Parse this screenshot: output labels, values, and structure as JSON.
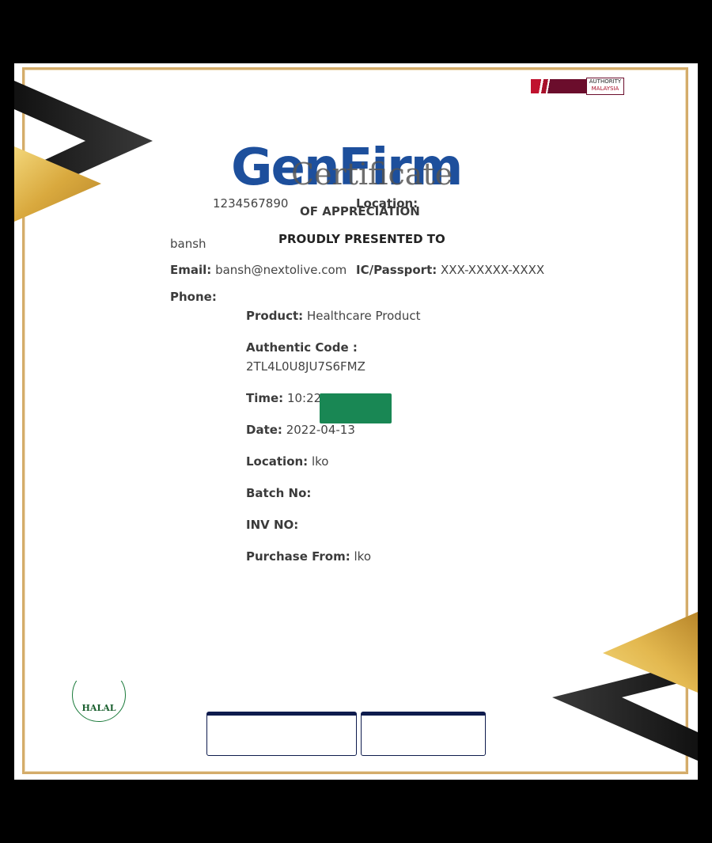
{
  "header": {
    "logo_text": "GenFirm",
    "certificate_title": "Certificate",
    "subtitle": "OF APPRECIATION",
    "presented_to": "PROUDLY PRESENTED TO",
    "authority_badge": {
      "line1": "AUTHORITY",
      "line2": "MALAYSIA"
    }
  },
  "recipient": {
    "id_number": "1234567890",
    "location_label": "Location:",
    "name": "bansh",
    "email_label": "Email:",
    "email": "bansh@nextolive.com",
    "ic_label": "IC/Passport:",
    "ic_value": "XXX-XXXXX-XXXX",
    "phone_label": "Phone:",
    "phone": ""
  },
  "details": {
    "product_label": "Product:",
    "product": "Healthcare Product",
    "code_label": "Authentic Code :",
    "code": "2TL4L0U8JU7S6FMZ",
    "time_label": "Time:",
    "time": "10:22",
    "date_label": "Date:",
    "date": "2022-04-13",
    "location_label": "Location:",
    "location": "lko",
    "batch_label": "Batch No:",
    "batch": "",
    "inv_label": "INV NO:",
    "inv": "",
    "purchase_label": "Purchase From:",
    "purchase": "lko"
  },
  "footer": {
    "halal_text": "HALAL"
  },
  "colors": {
    "gold": "#d4ac6a",
    "brand_blue": "#1d4f9c",
    "status_green": "#198754",
    "button_border": "#0e1b4d"
  }
}
